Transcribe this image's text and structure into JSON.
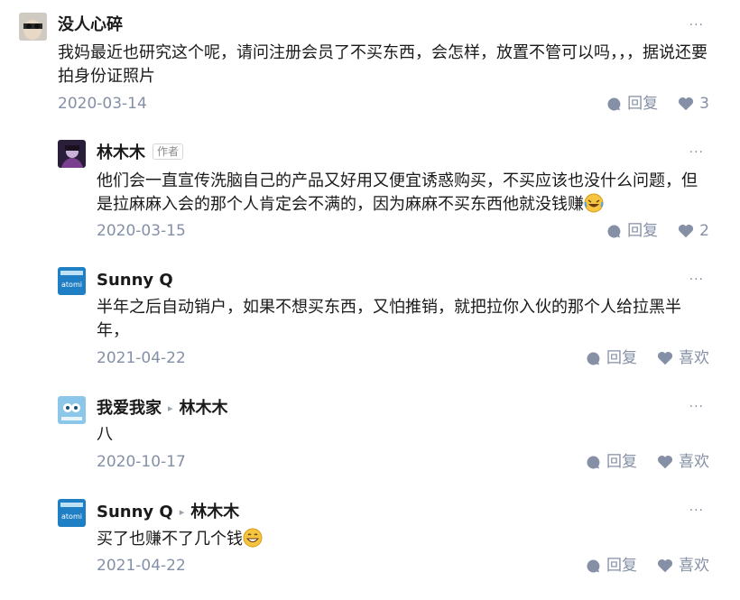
{
  "comments": [
    {
      "author": "没人心碎",
      "text": "我妈最近也研究这个呢，请问注册会员了不买东西，会怎样，放置不管可以吗，，，据说还要拍身份证照片",
      "date": "2020-03-14",
      "reply_label": "回复",
      "like_label": "3",
      "more": "···"
    },
    {
      "author": "林木木",
      "author_tag": "作者",
      "text": "他们会一直宣传洗脑自己的产品又好用又便宜诱惑购买，不买应该也没什么问题，但是拉麻麻入会的那个人肯定会不满的，因为麻麻不买东西他就没钱赚",
      "emoji": "laughing-tears-emoji",
      "date": "2020-03-15",
      "reply_label": "回复",
      "like_label": "2",
      "more": "···"
    },
    {
      "author": "Sunny Q",
      "text": "半年之后自动销户，如果不想买东西，又怕推销，就把拉你入伙的那个人给拉黑半年，",
      "date": "2021-04-22",
      "reply_label": "回复",
      "like_label": "喜欢",
      "more": "···"
    },
    {
      "author": "我爱我家",
      "reply_to": "林木木",
      "text": "八",
      "date": "2020-10-17",
      "reply_label": "回复",
      "like_label": "喜欢",
      "more": "···"
    },
    {
      "author": "Sunny Q",
      "reply_to": "林木木",
      "text": "买了也赚不了几个钱",
      "emoji": "grinning-emoji",
      "date": "2021-04-22",
      "reply_label": "回复",
      "like_label": "喜欢",
      "more": "···"
    }
  ],
  "colors": {
    "meta": "#8590a6",
    "text": "#1a1a1a",
    "icon": "#8590a6"
  }
}
